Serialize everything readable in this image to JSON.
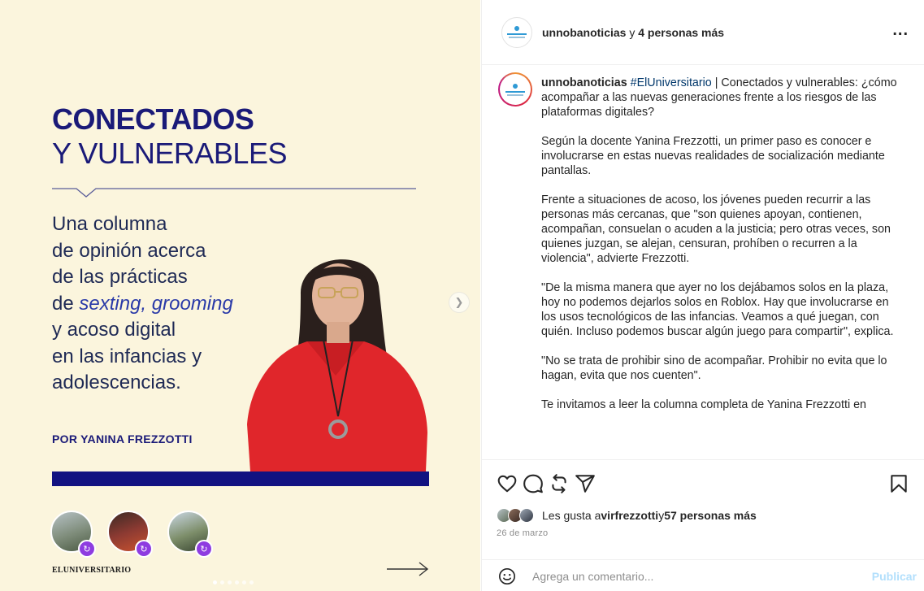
{
  "media": {
    "title_line1": "CONECTADOS",
    "title_line2": "Y VULNERABLES",
    "subtitle_l1": "Una columna",
    "subtitle_l2": "de opinión acerca",
    "subtitle_l3": "de las prácticas",
    "subtitle_l4_prefix": "de ",
    "subtitle_l4_em": "sexting, grooming",
    "subtitle_l5": "y acoso digital",
    "subtitle_l6": "en las infancias y",
    "subtitle_l7": "adolescencias.",
    "byline": "POR YANINA FREZZOTTI",
    "brand": "ELUNIVERSITARIO",
    "next_icon": "chevron-right-icon",
    "colors": {
      "background": "#fbf5dd",
      "navy": "#1a1a78",
      "bar": "#121281",
      "shirt": "#e0262b"
    }
  },
  "header": {
    "username": "unnobanoticias",
    "connector": " y ",
    "others": "4 personas más",
    "more_icon": "more-horizontal-icon",
    "more_label": "..."
  },
  "caption": {
    "username": "unnobanoticias",
    "hashtag": "#ElUniversitario",
    "intro": " | Conectados y vulnerables: ¿cómo acompañar a las nuevas generaciones frente a los riesgos de las plataformas digitales?",
    "p2": "Según la docente Yanina Frezzotti, un primer paso es conocer e involucrarse en estas nuevas realidades de socialización mediante pantallas.",
    "p3": "Frente a situaciones de acoso, los jóvenes pueden recurrir a las personas más cercanas, que \"son quienes apoyan, contienen, acompañan, consuelan o acuden a la justicia; pero otras veces, son quienes juzgan, se alejan, censuran, prohíben o recurren a la violencia\", advierte Frezzotti.",
    "p4": "\"De la misma manera que ayer no los dejábamos solos en la plaza, hoy no podemos dejarlos solos en Roblox. Hay que involucrarse en los usos tecnológicos de las infancias. Veamos a qué juegan, con quién. Incluso podemos buscar algún juego para compartir\", explica.",
    "p5": "\"No se trata de prohibir sino de acompañar. Prohibir no evita que lo hagan, evita que nos cuenten\".",
    "p6": "Te invitamos a leer la columna completa de Yanina Frezzotti en"
  },
  "actions": {
    "like_icon": "heart-icon",
    "comment_icon": "comment-icon",
    "repost_icon": "repost-icon",
    "share_icon": "send-icon",
    "save_icon": "bookmark-icon"
  },
  "likes": {
    "prefix": "Les gusta a ",
    "user": "virfrezzotti",
    "connector": " y ",
    "others": "57 personas más"
  },
  "date": "26 de marzo",
  "comment": {
    "emoji_icon": "emoji-icon",
    "placeholder": "Agrega un comentario...",
    "publish_label": "Publicar"
  }
}
